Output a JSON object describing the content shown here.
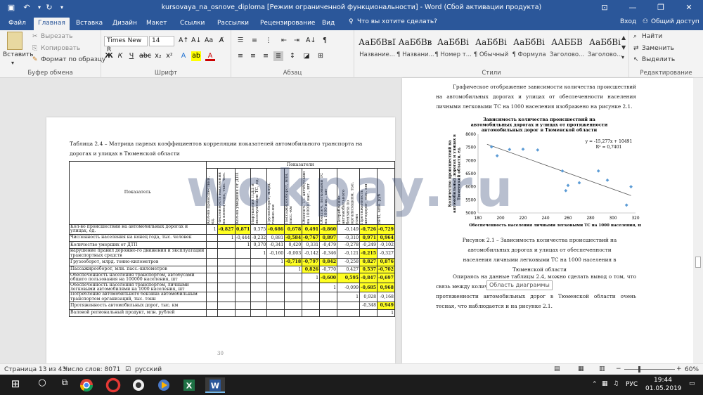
{
  "titlebar": {
    "title": "kursovaya_na_osnove_diploma [Режим ограниченной функциональности] - Word (Сбой активации продукта)"
  },
  "tabs": [
    "Файл",
    "Главная",
    "Вставка",
    "Дизайн",
    "Макет",
    "Ссылки",
    "Рассылки",
    "Рецензирование",
    "Вид"
  ],
  "tellme": "Что вы хотите сделать?",
  "signin": "Вход",
  "share": "Общий доступ",
  "ribbon": {
    "clipboard": {
      "paste": "Вставить",
      "cut": "Вырезать",
      "copy": "Копировать",
      "format_painter": "Формат по образцу",
      "label": "Буфер обмена"
    },
    "font": {
      "name": "Times New R",
      "size": "14",
      "label": "Шрифт"
    },
    "paragraph": {
      "label": "Абзац"
    },
    "styles": {
      "label": "Стили",
      "items": [
        {
          "preview": "АаБбВвГ",
          "name": "Название..."
        },
        {
          "preview": "АаБбВв",
          "name": "¶ Названи..."
        },
        {
          "preview": "АаБбВі",
          "name": "¶ Номер т..."
        },
        {
          "preview": "АаБбВі",
          "name": "¶ Обычный"
        },
        {
          "preview": "АаБбВі",
          "name": "¶ Формула"
        },
        {
          "preview": "ААББВ",
          "name": "Заголово..."
        },
        {
          "preview": "АаБбВі",
          "name": "Заголово..."
        }
      ]
    },
    "editing": {
      "find": "Найти",
      "replace": "Заменить",
      "select": "Выделить",
      "label": "Редактирование"
    }
  },
  "left_page": {
    "caption": "Таблица 2.4 – Матрица парных коэффициентов корреляции показателей автомобильного транспорта на дорогах и улицах в Тюменской области",
    "header_row": "Показатели",
    "row_header": "Показатель",
    "columns": [
      "Кол-во происшествий, ед.",
      "Численность населения на конец года, тыс. чел.",
      "Кол-во умерших от ДТП",
      "Нарушения ПДД и эксплуатации ТС, ед.",
      "Грузооборот, млрд. тонно-км",
      "Пассажирооборот, млн. пасс.-км",
      "Обеспеч. ТС автобусами на 100000 нас., шт",
      "Обеспеч. легковыми ТС на 1000 нас., шт",
      "Потребление автомобильного бензина по организациям, тыс. тонн",
      "Протяженность автодорог, тыс. км",
      "ВРП, млн. руб"
    ],
    "rows": [
      {
        "label": "Кол-во происшествий на автомобильных дорогах и улицах, ед.",
        "cells": [
          "1",
          "-0,827",
          "0,871",
          "0,375",
          "-0,686",
          "0,678",
          "0,491",
          "-0,860",
          "-0,149",
          "-0,726",
          "-0,729"
        ]
      },
      {
        "label": "Численность населения на конец года, тыс. человек",
        "cells": [
          "",
          "1",
          "-0,444",
          "-0,232",
          "0,881",
          "-0,584",
          "-0,767",
          "0,897",
          "-0,310",
          "0,971",
          "0,964"
        ]
      },
      {
        "label": "Количество умерших от ДТП",
        "cells": [
          "",
          "",
          "1",
          "0,370",
          "-0,341",
          "0,420",
          "0,331",
          "-0,479",
          "-0,278",
          "-0,249",
          "-0,102"
        ]
      },
      {
        "label": "нарушение правил дорожно-го движения и эксплуатации транспортных средств",
        "cells": [
          "",
          "",
          "",
          "1",
          "-0,160",
          "-0,003",
          "-0,142",
          "-0,346",
          "-0,121",
          "-0,215",
          "-0,327"
        ]
      },
      {
        "label": "Грузооборот, млрд. тонно-километров",
        "cells": [
          "",
          "",
          "",
          "",
          "1",
          "-0,718",
          "-0,797",
          "0,842",
          "-0,258",
          "0,827",
          "0,876"
        ]
      },
      {
        "label": "Пассажирооборот, млн. пасс.-километров",
        "cells": [
          "",
          "",
          "",
          "",
          "",
          "1",
          "0,826",
          "-0,770",
          "0,427",
          "0,537",
          "-0,702"
        ]
      },
      {
        "label": "Обеспеченность населения транспортом, автобусами общего пользования на 100000 населения, шт",
        "cells": [
          "",
          "",
          "",
          "",
          "",
          "",
          "1",
          "-0,600",
          "0,595",
          "-0,847",
          "-0,697"
        ]
      },
      {
        "label": "Обеспеченность населения транспортом, личными легковыми автомобилями на 1000 населения, шт",
        "cells": [
          "",
          "",
          "",
          "",
          "",
          "",
          "",
          "1",
          "-0,099",
          "-0,685",
          "0,968"
        ]
      },
      {
        "label": "Потребление автомобильного бензина автомобильным транспортом организаций, тыс. тонн",
        "cells": [
          "",
          "",
          "",
          "",
          "",
          "",
          "",
          "",
          "1",
          "0,928",
          "-0,168"
        ]
      },
      {
        "label": "Протяженность автомобильных дорог, тыс. км",
        "cells": [
          "",
          "",
          "",
          "",
          "",
          "",
          "",
          "",
          "",
          "-0,348",
          "0,949"
        ]
      },
      {
        "label": "Валовой региональный продукт, млн. рублей",
        "cells": [
          "",
          "",
          "",
          "",
          "",
          "",
          "",
          "",
          "",
          "",
          "1"
        ]
      }
    ],
    "page_number": "30"
  },
  "right_page": {
    "para1": "Графическое отображение зависимости количества происшествий на автомобильных дорогах и улицах от обеспеченности населения личными легковыми ТС на 1000 населения изображено на рисунке 2.1.",
    "figure_caption": "Рисунок 2.1 – Зависимость количества происшествий на автомобильных дорогах и улицах от обеспеченности населения личными легковыми ТС на 1000 населения в Тюменской области",
    "para2a": "Опираясь на данные таблицы 2.4, можно сделать вывод о том, что связь между количеством",
    "para2b": "мобильных дорогах и улицах от",
    "para2c": "обеспеченности населения личными легковыми ТС на 1000 населения, шт",
    "para2d": "протяженности автомобильных дорог в Тюменской области очень тесная, что наблюдается и на рисунке 2.1.",
    "tooltip": "Область диаграммы"
  },
  "chart_data": {
    "type": "scatter",
    "title": "Зависимость количества происшествий на автомобильных дорогах и улицах от протяженности автомобильных дорог в Тюменской области",
    "xlabel": "Обеспеченность населения личными легковыми ТС на 1000 населения, шт",
    "ylabel": "Количество происшествий на автомобильных дорогах и улицах в Тюменской области, ед.",
    "xlim": [
      180,
      320
    ],
    "ylim": [
      5000,
      8000
    ],
    "xticks": [
      180,
      200,
      220,
      240,
      260,
      280,
      300,
      320
    ],
    "yticks": [
      5000,
      5500,
      6000,
      6500,
      7000,
      7500,
      8000
    ],
    "equation": "y = -15,277x + 10491",
    "r2": "R² = 0,7401",
    "points": [
      [
        192,
        7520
      ],
      [
        197,
        7180
      ],
      [
        208,
        7420
      ],
      [
        220,
        7430
      ],
      [
        233,
        7400
      ],
      [
        255,
        6600
      ],
      [
        260,
        6050
      ],
      [
        258,
        5850
      ],
      [
        270,
        6150
      ],
      [
        287,
        6600
      ],
      [
        295,
        6250
      ],
      [
        312,
        5300
      ],
      [
        316,
        6000
      ]
    ],
    "trend": {
      "slope": -15.277,
      "intercept": 10491
    },
    "color": "#5b9bd5"
  },
  "status": {
    "page": "Страница 13 из 43",
    "words": "Число слов: 8071",
    "lang": "русский",
    "zoom": "60%"
  },
  "taskbar": {
    "lang": "РУС",
    "time": "19:44",
    "date": "01.05.2019"
  },
  "watermark": "wokpay.ru"
}
